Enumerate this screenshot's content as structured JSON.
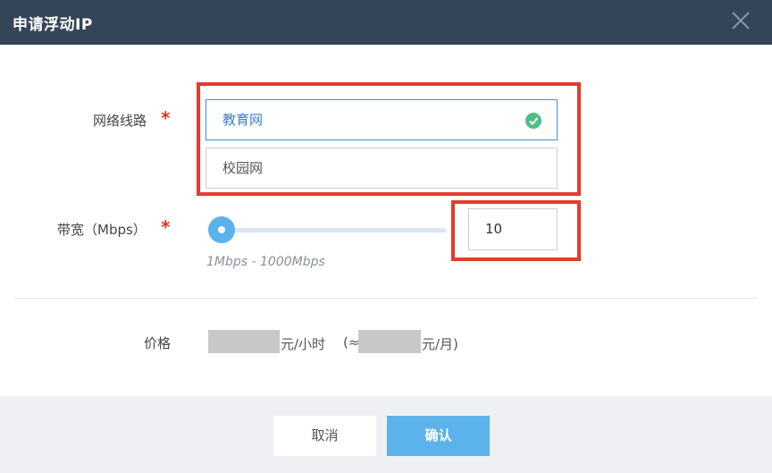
{
  "dialog": {
    "title": "申请浮动IP"
  },
  "network": {
    "label": "网络线路",
    "options": [
      {
        "label": "教育网",
        "selected": true
      },
      {
        "label": "校园网",
        "selected": false
      }
    ]
  },
  "bandwidth": {
    "label": "带宽（Mbps）",
    "value": "10",
    "range_text": "1Mbps - 1000Mbps"
  },
  "price": {
    "label": "价格",
    "hourly_unit": "元/小时",
    "monthly_prefix": "(≈",
    "monthly_unit": "元/月)"
  },
  "buttons": {
    "cancel": "取消",
    "confirm": "确认"
  },
  "colors": {
    "header": "#354558",
    "accent": "#5cb2ea",
    "required": "#e2342b",
    "highlight_box": "#e23b30",
    "check": "#4fbf8a"
  }
}
